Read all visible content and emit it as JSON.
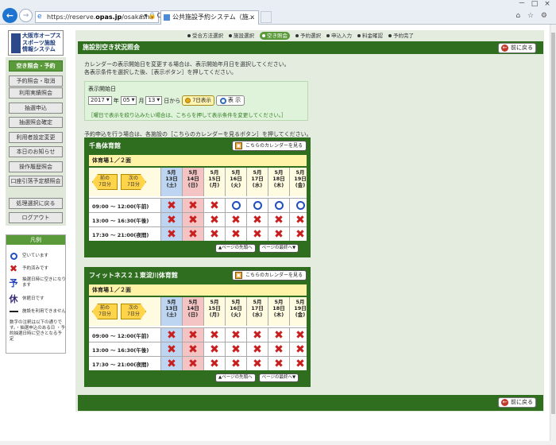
{
  "browser": {
    "url_prefix": "https://reserve.",
    "url_host": "opas.jp",
    "url_rest": "/osakashi/",
    "tab_title": "公共施設予約システム（施...",
    "tab_close": "×",
    "window_controls": [
      "－",
      "□",
      "×"
    ],
    "tools": "⌂ ☆ ⚙"
  },
  "logo": {
    "lines": [
      "大阪市オープス",
      "スポーツ施設",
      "情報システム"
    ]
  },
  "sidebar": {
    "items": [
      {
        "label": "空き照会・予約",
        "active": true
      },
      {
        "label": "予約照会・取消",
        "active": false
      },
      {
        "label": "利用実績照会",
        "active": false
      },
      {
        "label": "抽選申込",
        "active": false
      },
      {
        "label": "抽選照会確定",
        "active": false
      },
      {
        "label": "利用者設定変更",
        "active": false
      },
      {
        "label": "本日のお知らせ",
        "active": false
      },
      {
        "label": "操作履歴照会",
        "active": false
      },
      {
        "label": "口座引落予定額照会",
        "active": false
      },
      {
        "label": "処理選択に戻る",
        "active": false
      },
      {
        "label": "ログアウト",
        "active": false
      }
    ]
  },
  "legend": {
    "title": "凡例",
    "rows": [
      {
        "sym": "circle",
        "text": "空いています"
      },
      {
        "sym": "cross",
        "text": "予約済みです"
      },
      {
        "sym": "yo",
        "glyph": "予",
        "text": "抽選日時に空きになります"
      },
      {
        "sym": "kyu",
        "glyph": "休",
        "text": "休館日です"
      },
      {
        "sym": "bar",
        "text": "施設を利用できません"
      }
    ],
    "note": "数字の注釈は以下の通りです。・抽選申込のある日 ・予約抽選日時に空きとなる予定"
  },
  "steps": [
    "受合方法選択",
    "施設選択",
    "空き照会",
    "予約選択",
    "申込入力",
    "料金確認",
    "予約完了"
  ],
  "current_step": 2,
  "title": "施設別空き状況照会",
  "back_label": "前に戻る",
  "intro": [
    "カレンダーの表示開始日を変更する場合は、表示開始年月日を選択してください。",
    "各表示条件を選択した後、［表示ボタン］を押してください。"
  ],
  "datebox": {
    "label": "表示開始日",
    "year": "2017",
    "year_unit": "年",
    "month": "05",
    "month_unit": "月",
    "day": "13",
    "day_unit": "日から",
    "week_label": "7日表示",
    "show_label": "表 示",
    "note": "［曜日で表示を絞り込みたい場合は、こちらを押して表示条件を変更してください。］"
  },
  "info2": "予約申込を行う場合は、各施設の［こちらのカレンダーを見るボタン］を押してください。",
  "calendar_button": "こちらのカレンダーを見る",
  "nav": {
    "prev": [
      "前の",
      "7日分"
    ],
    "next": [
      "次の",
      "7日分"
    ]
  },
  "page_top": "▲ページの先頭へ",
  "page_bottom": "ページの最終へ▼",
  "days": [
    {
      "m": "5月",
      "d": "13日",
      "w": "(土)",
      "tone": "blue"
    },
    {
      "m": "5月",
      "d": "14日",
      "w": "(日)",
      "tone": "pink"
    },
    {
      "m": "5月",
      "d": "15日",
      "w": "(月)",
      "tone": ""
    },
    {
      "m": "5月",
      "d": "16日",
      "w": "(火)",
      "tone": ""
    },
    {
      "m": "5月",
      "d": "17日",
      "w": "(水)",
      "tone": ""
    },
    {
      "m": "5月",
      "d": "18日",
      "w": "(木)",
      "tone": ""
    },
    {
      "m": "5月",
      "d": "19日",
      "w": "(金)",
      "tone": ""
    }
  ],
  "facilities": [
    {
      "name": "千島体育館",
      "room": "体育場１／２面",
      "slots": [
        {
          "time": "09:00 ～ 12:00(午前)",
          "status": [
            "x",
            "x",
            "x",
            "o",
            "o",
            "o",
            "o"
          ]
        },
        {
          "time": "13:00 ～ 16:30(午後)",
          "status": [
            "x",
            "x",
            "x",
            "x",
            "x",
            "x",
            "x"
          ]
        },
        {
          "time": "17:30 ～ 21:00(夜間)",
          "status": [
            "x",
            "x",
            "x",
            "x",
            "x",
            "x",
            "x"
          ]
        }
      ]
    },
    {
      "name": "フィットネス２１東淀川体育館",
      "room": "体育場１／２面",
      "slots": [
        {
          "time": "09:00 ～ 12:00(午前)",
          "status": [
            "x",
            "x",
            "x",
            "x",
            "x",
            "x",
            "x"
          ]
        },
        {
          "time": "13:00 ～ 16:30(午後)",
          "status": [
            "x",
            "x",
            "x",
            "x",
            "x",
            "x",
            "x"
          ]
        },
        {
          "time": "17:30 ～ 21:00(夜間)",
          "status": [
            "x",
            "x",
            "x",
            "x",
            "x",
            "x",
            "x"
          ]
        }
      ]
    }
  ]
}
